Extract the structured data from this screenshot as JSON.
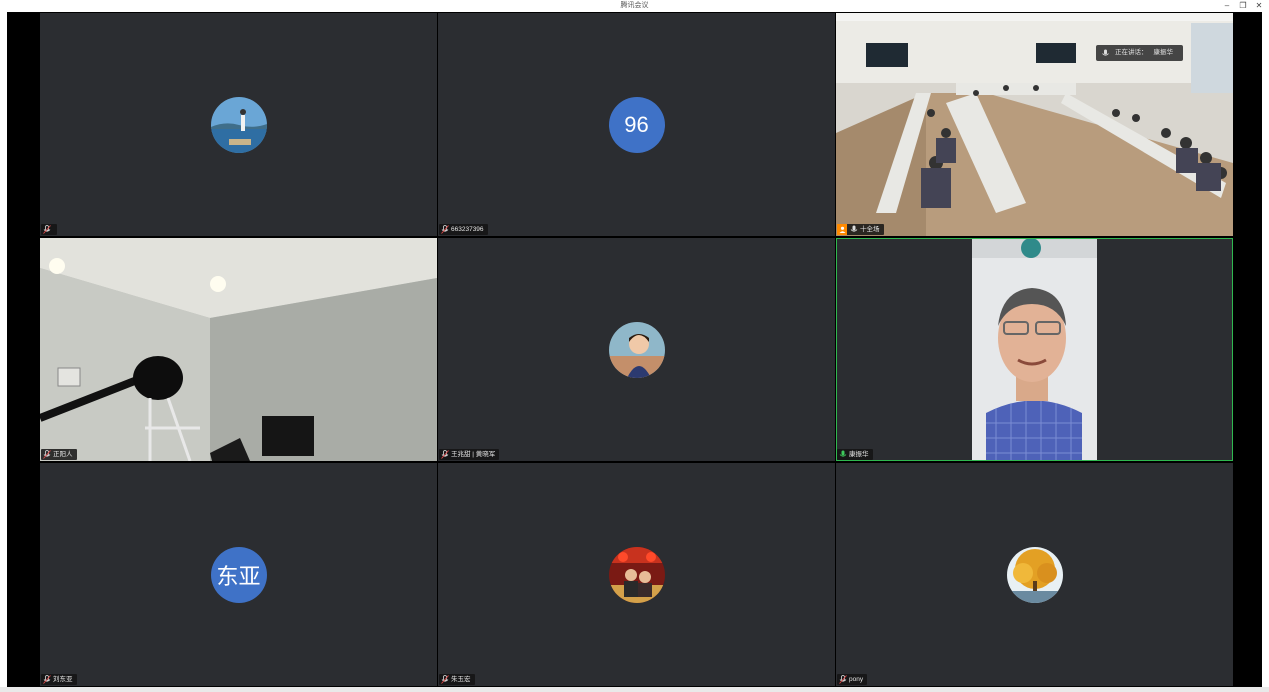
{
  "window": {
    "title": "腾讯会议",
    "controls": {
      "minimize": "–",
      "restore": "❐",
      "close": "✕"
    }
  },
  "speaking_banner": {
    "label": "正在讲话：",
    "name": "康振华"
  },
  "tiles": [
    {
      "name": "",
      "avatar_type": "image",
      "avatar_icon": "sea-photo-avatar"
    },
    {
      "name": "663237396",
      "avatar_type": "text",
      "avatar_text": "96"
    },
    {
      "name": "十全场",
      "avatar_type": "video",
      "host": true
    },
    {
      "name": "正阳人",
      "avatar_type": "video"
    },
    {
      "name": "王兆甜 | 黄晓军",
      "avatar_type": "image",
      "avatar_icon": "child-photo-avatar"
    },
    {
      "name": "康振华",
      "avatar_type": "video",
      "active": true
    },
    {
      "name": "刘东亚",
      "avatar_type": "text",
      "avatar_text": "东亚"
    },
    {
      "name": "朱玉宏",
      "avatar_type": "image",
      "avatar_icon": "festive-photo-avatar"
    },
    {
      "name": "pony",
      "avatar_type": "image",
      "avatar_icon": "autumn-tree-avatar"
    }
  ],
  "colors": {
    "tile_bg": "#2b2d31",
    "avatar_blue": "#3f72c7",
    "active_border": "#2fb84f",
    "host_badge": "#ff8a00"
  }
}
